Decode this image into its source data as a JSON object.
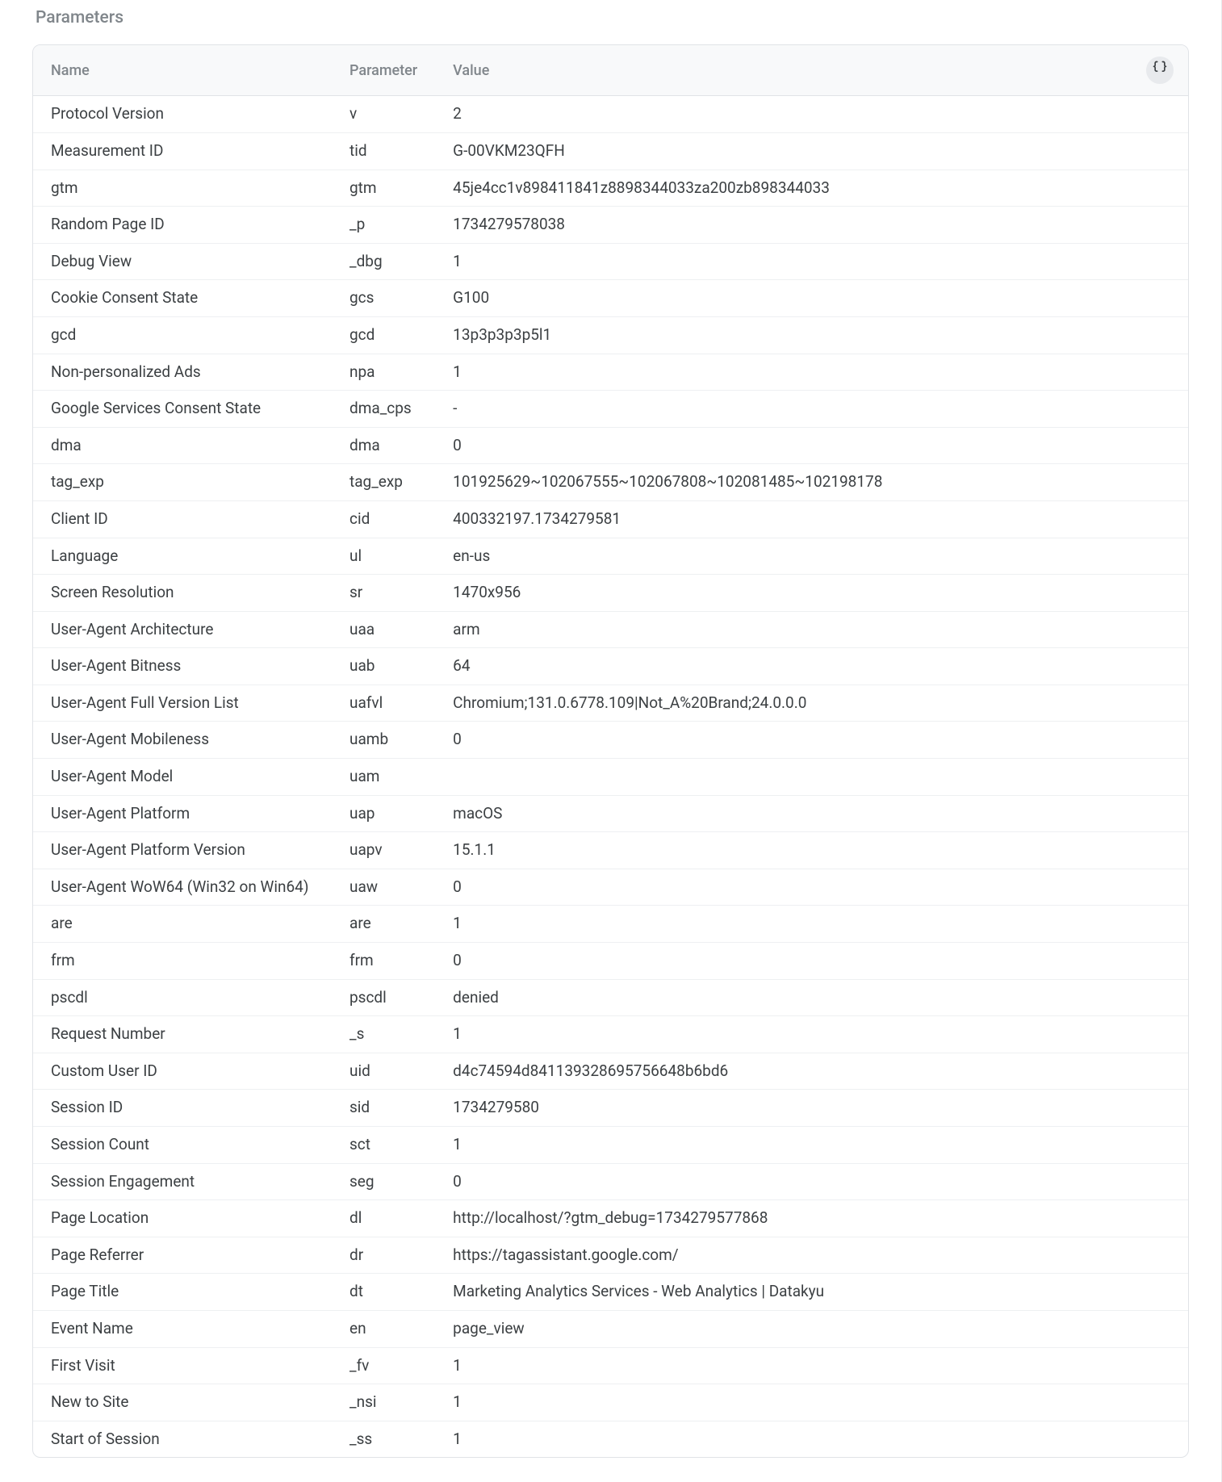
{
  "section_title": "Parameters",
  "columns": {
    "name": "Name",
    "parameter": "Parameter",
    "value": "Value"
  },
  "rows": [
    {
      "name": "Protocol Version",
      "param": "v",
      "value": "2"
    },
    {
      "name": "Measurement ID",
      "param": "tid",
      "value": "G-00VKM23QFH"
    },
    {
      "name": "gtm",
      "param": "gtm",
      "value": "45je4cc1v898411841z8898344033za200zb898344033"
    },
    {
      "name": "Random Page ID",
      "param": "_p",
      "value": "1734279578038"
    },
    {
      "name": "Debug View",
      "param": "_dbg",
      "value": "1"
    },
    {
      "name": "Cookie Consent State",
      "param": "gcs",
      "value": "G100"
    },
    {
      "name": "gcd",
      "param": "gcd",
      "value": "13p3p3p3p5l1"
    },
    {
      "name": "Non-personalized Ads",
      "param": "npa",
      "value": "1"
    },
    {
      "name": "Google Services Consent State",
      "param": "dma_cps",
      "value": "-"
    },
    {
      "name": "dma",
      "param": "dma",
      "value": "0"
    },
    {
      "name": "tag_exp",
      "param": "tag_exp",
      "value": "101925629~102067555~102067808~102081485~102198178"
    },
    {
      "name": "Client ID",
      "param": "cid",
      "value": "400332197.1734279581"
    },
    {
      "name": "Language",
      "param": "ul",
      "value": "en-us"
    },
    {
      "name": "Screen Resolution",
      "param": "sr",
      "value": "1470x956"
    },
    {
      "name": "User-Agent Architecture",
      "param": "uaa",
      "value": "arm"
    },
    {
      "name": "User-Agent Bitness",
      "param": "uab",
      "value": "64"
    },
    {
      "name": "User-Agent Full Version List",
      "param": "uafvl",
      "value": "Chromium;131.0.6778.109|Not_A%20Brand;24.0.0.0"
    },
    {
      "name": "User-Agent Mobileness",
      "param": "uamb",
      "value": "0"
    },
    {
      "name": "User-Agent Model",
      "param": "uam",
      "value": ""
    },
    {
      "name": "User-Agent Platform",
      "param": "uap",
      "value": "macOS"
    },
    {
      "name": "User-Agent Platform Version",
      "param": "uapv",
      "value": "15.1.1"
    },
    {
      "name": "User-Agent WoW64 (Win32 on Win64)",
      "param": "uaw",
      "value": "0"
    },
    {
      "name": "are",
      "param": "are",
      "value": "1"
    },
    {
      "name": "frm",
      "param": "frm",
      "value": "0"
    },
    {
      "name": "pscdl",
      "param": "pscdl",
      "value": "denied"
    },
    {
      "name": "Request Number",
      "param": "_s",
      "value": "1"
    },
    {
      "name": "Custom User ID",
      "param": "uid",
      "value": "d4c74594d841139328695756648b6bd6"
    },
    {
      "name": "Session ID",
      "param": "sid",
      "value": "1734279580"
    },
    {
      "name": "Session Count",
      "param": "sct",
      "value": "1"
    },
    {
      "name": "Session Engagement",
      "param": "seg",
      "value": "0"
    },
    {
      "name": "Page Location",
      "param": "dl",
      "value": "http://localhost/?gtm_debug=1734279577868"
    },
    {
      "name": "Page Referrer",
      "param": "dr",
      "value": "https://tagassistant.google.com/"
    },
    {
      "name": "Page Title",
      "param": "dt",
      "value": "Marketing Analytics Services - Web Analytics | Datakyu"
    },
    {
      "name": "Event Name",
      "param": "en",
      "value": "page_view"
    },
    {
      "name": "First Visit",
      "param": "_fv",
      "value": "1"
    },
    {
      "name": "New to Site",
      "param": "_nsi",
      "value": "1"
    },
    {
      "name": "Start of Session",
      "param": "_ss",
      "value": "1"
    }
  ]
}
